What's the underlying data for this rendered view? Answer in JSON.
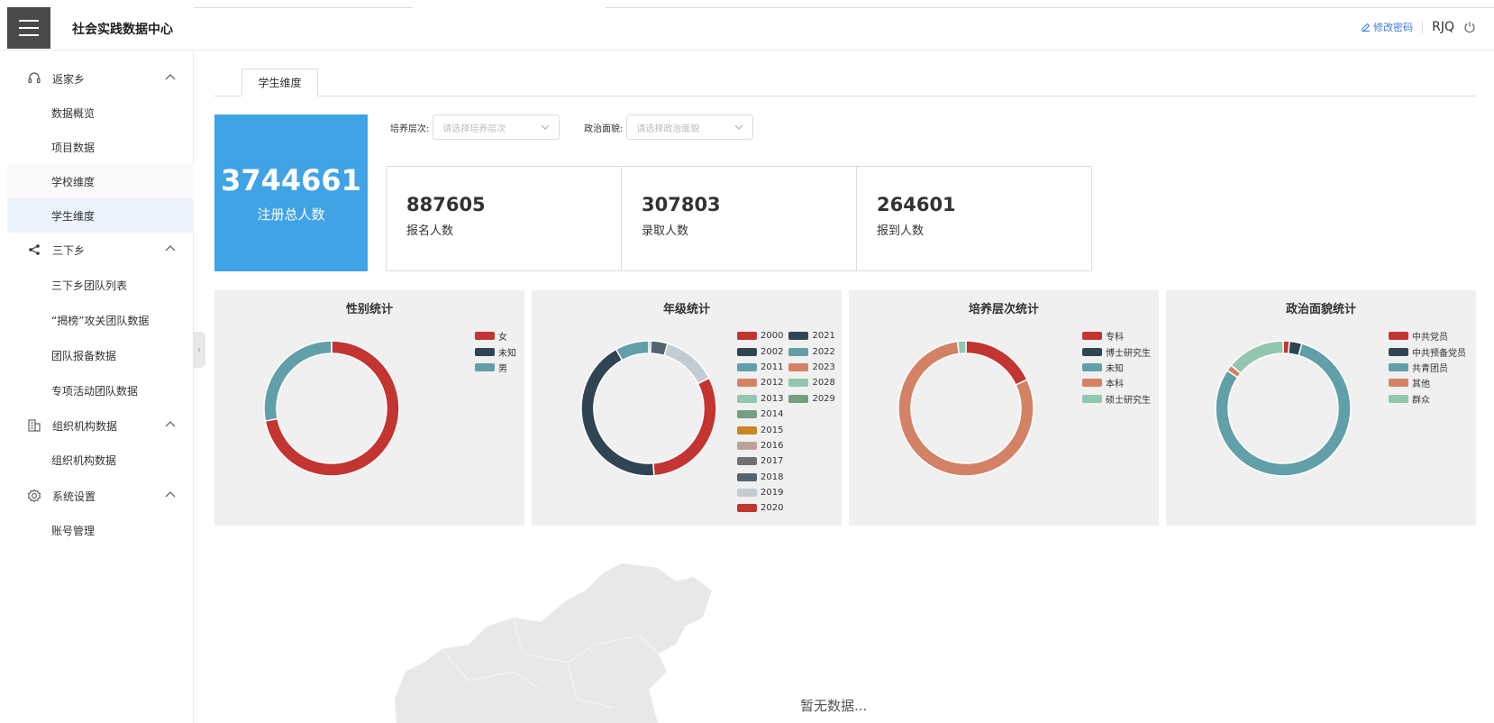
{
  "header": {
    "app_title": "社会实践数据中心",
    "change_password": "修改密码",
    "user": "RJQ"
  },
  "sidebar": {
    "groups": [
      {
        "label": "返家乡",
        "icon": "headset-icon",
        "items": [
          "数据概览",
          "项目数据",
          "学校维度",
          "学生维度"
        ]
      },
      {
        "label": "三下乡",
        "icon": "share-icon",
        "items": [
          "三下乡团队列表",
          "“揭榜”攻关团队数据",
          "团队报备数据",
          "专项活动团队数据"
        ]
      },
      {
        "label": "组织机构数据",
        "icon": "building-icon",
        "items": [
          "组织机构数据"
        ]
      },
      {
        "label": "系统设置",
        "icon": "gear-icon",
        "items": [
          "账号管理"
        ]
      }
    ],
    "active_item": "学生维度"
  },
  "tabs": [
    {
      "label": "学生维度"
    }
  ],
  "total": {
    "value": "3744661",
    "label": "注册总人数"
  },
  "filters": {
    "level": {
      "label": "培养层次:",
      "placeholder": "请选择培养层次"
    },
    "political": {
      "label": "政治面貌:",
      "placeholder": "请选择政治面貌"
    }
  },
  "stats": [
    {
      "value": "887605",
      "label": "报名人数"
    },
    {
      "value": "307803",
      "label": "录取人数"
    },
    {
      "value": "264601",
      "label": "报到人数"
    }
  ],
  "chart_data": [
    {
      "type": "pie",
      "title": "性别统计",
      "series": [
        {
          "name": "女",
          "value": 72,
          "color": "#c23531"
        },
        {
          "name": "未知",
          "value": 0,
          "color": "#2f4554"
        },
        {
          "name": "男",
          "value": 28,
          "color": "#61a0a8"
        }
      ]
    },
    {
      "type": "pie",
      "title": "年级统计",
      "series": [
        {
          "name": "2000",
          "value": 0,
          "color": "#c23531"
        },
        {
          "name": "2002",
          "value": 0,
          "color": "#2f4554"
        },
        {
          "name": "2011",
          "value": 0,
          "color": "#61a0a8"
        },
        {
          "name": "2012",
          "value": 0,
          "color": "#d48265"
        },
        {
          "name": "2013",
          "value": 0,
          "color": "#91c7ae"
        },
        {
          "name": "2014",
          "value": 0,
          "color": "#749f83"
        },
        {
          "name": "2015",
          "value": 0,
          "color": "#ca8622"
        },
        {
          "name": "2016",
          "value": 0,
          "color": "#bda29a"
        },
        {
          "name": "2017",
          "value": 0.5,
          "color": "#6e7074"
        },
        {
          "name": "2018",
          "value": 4,
          "color": "#546570"
        },
        {
          "name": "2019",
          "value": 13,
          "color": "#c4ccd3"
        },
        {
          "name": "2020",
          "value": 31,
          "color": "#c23531"
        },
        {
          "name": "2021",
          "value": 43,
          "color": "#2f4554"
        },
        {
          "name": "2022",
          "value": 8,
          "color": "#61a0a8"
        },
        {
          "name": "2023",
          "value": 0,
          "color": "#d48265"
        },
        {
          "name": "2028",
          "value": 0,
          "color": "#91c7ae"
        },
        {
          "name": "2029",
          "value": 0,
          "color": "#749f83"
        }
      ],
      "legend_order": [
        "2000",
        "2002",
        "2011",
        "2012",
        "2013",
        "2014",
        "2015",
        "2016",
        "2017",
        "2018",
        "2019",
        "2020",
        "2021",
        "2022",
        "2023",
        "2028",
        "2029"
      ]
    },
    {
      "type": "pie",
      "title": "培养层次统计",
      "series": [
        {
          "name": "专科",
          "value": 18,
          "color": "#c23531"
        },
        {
          "name": "博士研究生",
          "value": 0,
          "color": "#2f4554"
        },
        {
          "name": "未知",
          "value": 0,
          "color": "#61a0a8"
        },
        {
          "name": "本科",
          "value": 80,
          "color": "#d48265"
        },
        {
          "name": "硕士研究生",
          "value": 2,
          "color": "#91c7ae"
        }
      ]
    },
    {
      "type": "pie",
      "title": "政治面貌统计",
      "series": [
        {
          "name": "中共党员",
          "value": 1.5,
          "color": "#c23531"
        },
        {
          "name": "中共预备党员",
          "value": 3,
          "color": "#2f4554"
        },
        {
          "name": "共青团员",
          "value": 80,
          "color": "#61a0a8"
        },
        {
          "name": "其他",
          "value": 1.5,
          "color": "#d48265"
        },
        {
          "name": "群众",
          "value": 14,
          "color": "#91c7ae"
        }
      ]
    }
  ],
  "map": {
    "empty_text": "暂无数据..."
  }
}
